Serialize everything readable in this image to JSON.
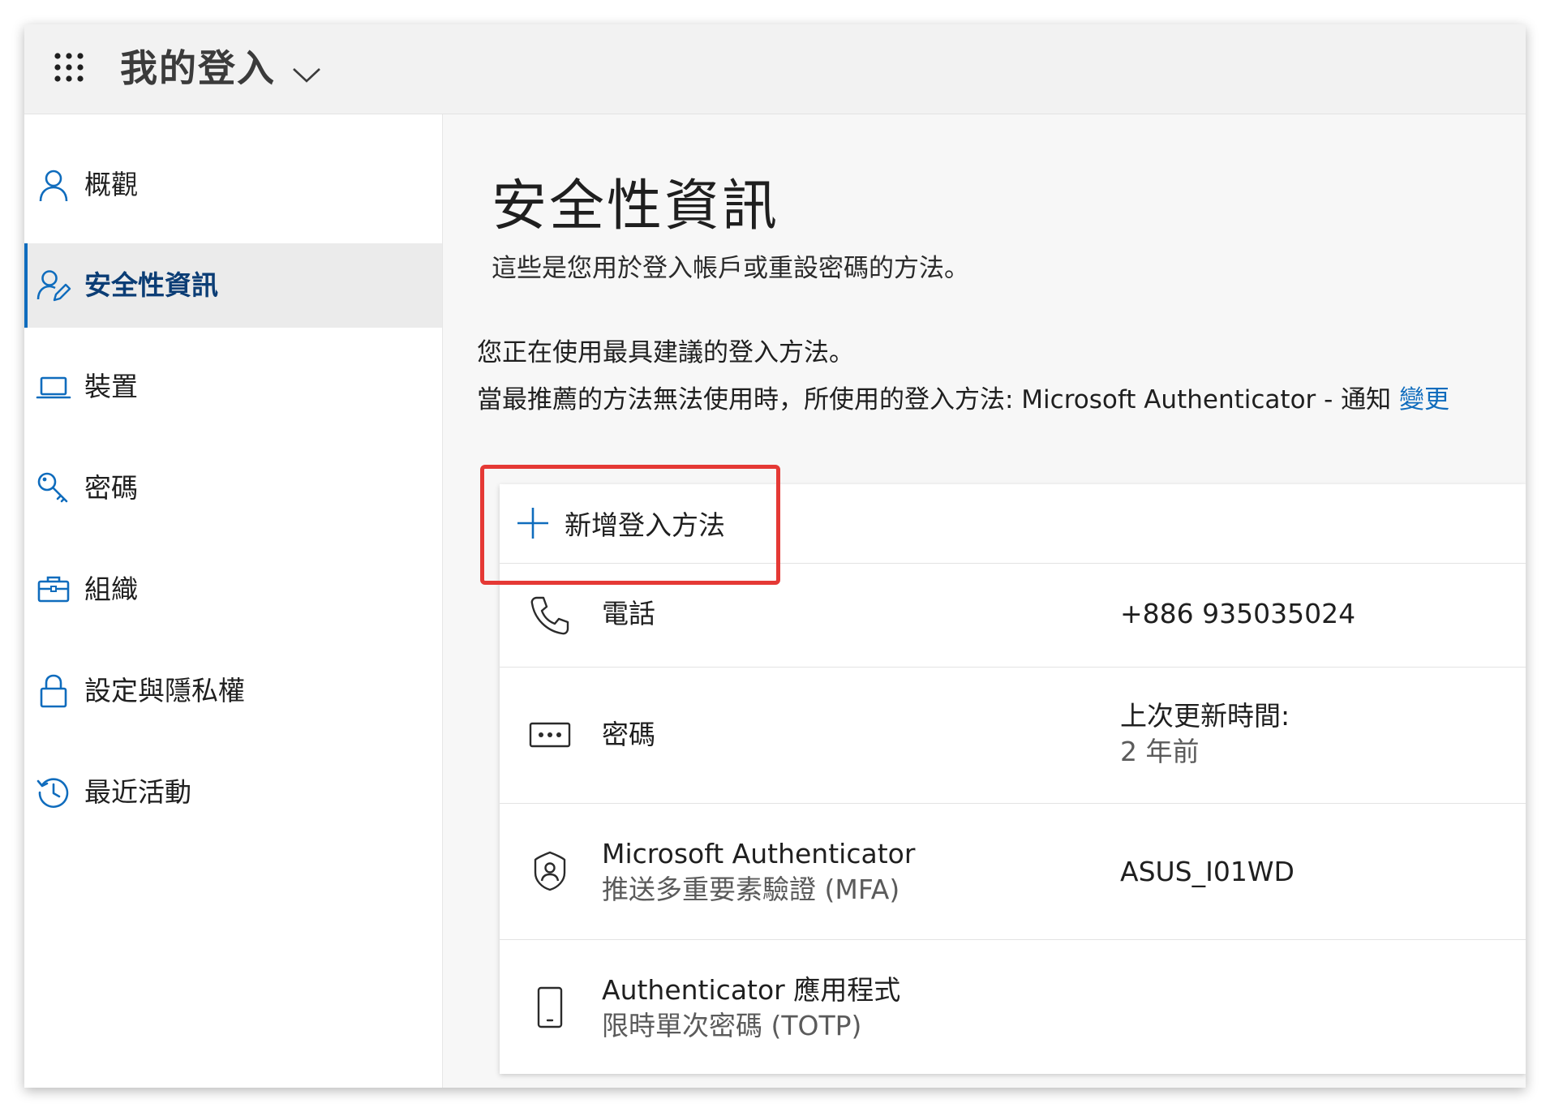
{
  "header": {
    "app_title": "我的登入"
  },
  "sidebar": {
    "items": [
      {
        "label": "概觀",
        "icon": "person-icon"
      },
      {
        "label": "安全性資訊",
        "icon": "person-edit-icon",
        "active": true
      },
      {
        "label": "裝置",
        "icon": "laptop-icon"
      },
      {
        "label": "密碼",
        "icon": "key-icon"
      },
      {
        "label": "組織",
        "icon": "briefcase-icon"
      },
      {
        "label": "設定與隱私權",
        "icon": "lock-icon"
      },
      {
        "label": "最近活動",
        "icon": "history-icon"
      }
    ]
  },
  "main": {
    "title": "安全性資訊",
    "subtitle": "這些是您用於登入帳戶或重設密碼的方法。",
    "recommended_text": "您正在使用最具建議的登入方法。",
    "fallback_text": "當最推薦的方法無法使用時，所使用的登入方法: Microsoft Authenticator - 通知",
    "change_link": "變更",
    "add_method_label": "新增登入方法",
    "methods": [
      {
        "icon": "phone-icon",
        "name": "電話",
        "value": "+886 935035024"
      },
      {
        "icon": "password-icon",
        "name": "密碼",
        "value_label": "上次更新時間:",
        "value": "2 年前"
      },
      {
        "icon": "authenticator-icon",
        "name": "Microsoft Authenticator",
        "sub": "推送多重要素驗證 (MFA)",
        "value": "ASUS_I01WD"
      },
      {
        "icon": "mobile-icon",
        "name": "Authenticator 應用程式",
        "sub": "限時單次密碼 (TOTP)"
      }
    ]
  },
  "colors": {
    "accent": "#0f6cbd",
    "highlight": "#e53935"
  }
}
